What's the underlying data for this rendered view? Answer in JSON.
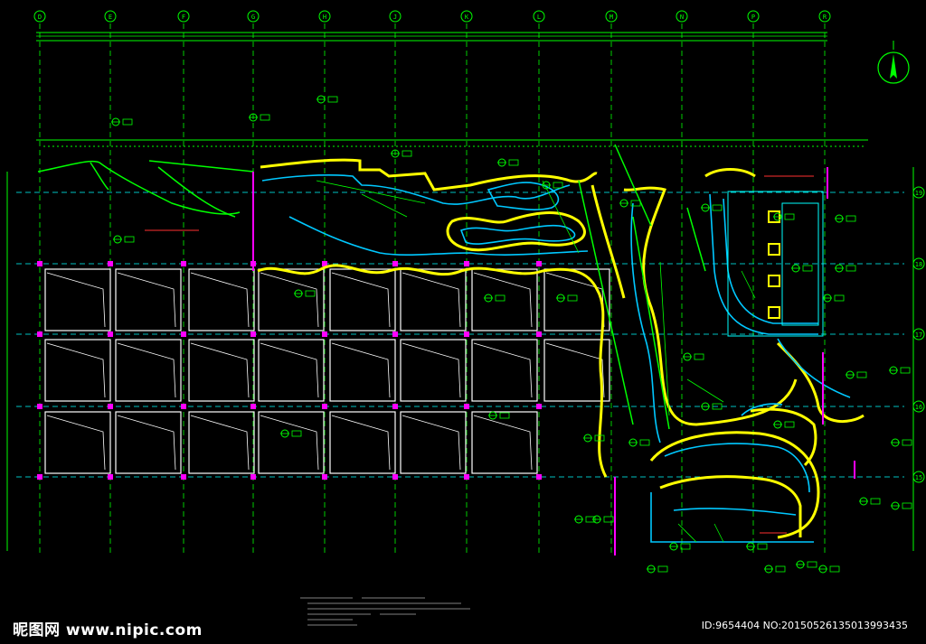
{
  "drawing": {
    "column_labels": [
      "D",
      "E",
      "F",
      "G",
      "H",
      "J",
      "K",
      "L",
      "M",
      "N",
      "P",
      "R"
    ],
    "row_labels": [
      "19",
      "18",
      "17",
      "16",
      "15"
    ],
    "colors": {
      "background": "#000000",
      "grid": "#00ff00",
      "dim": "#00ffff",
      "wall": "#ffff00",
      "water": "#00c8ff",
      "red": "#ff3030",
      "magenta": "#ff00ff",
      "white": "#ffffff"
    },
    "north_icon": "north-arrow-icon"
  },
  "watermark": {
    "site": "昵图网 www.nipic.com",
    "id_text": "ID:9654404 NO:20150526135013993435"
  }
}
